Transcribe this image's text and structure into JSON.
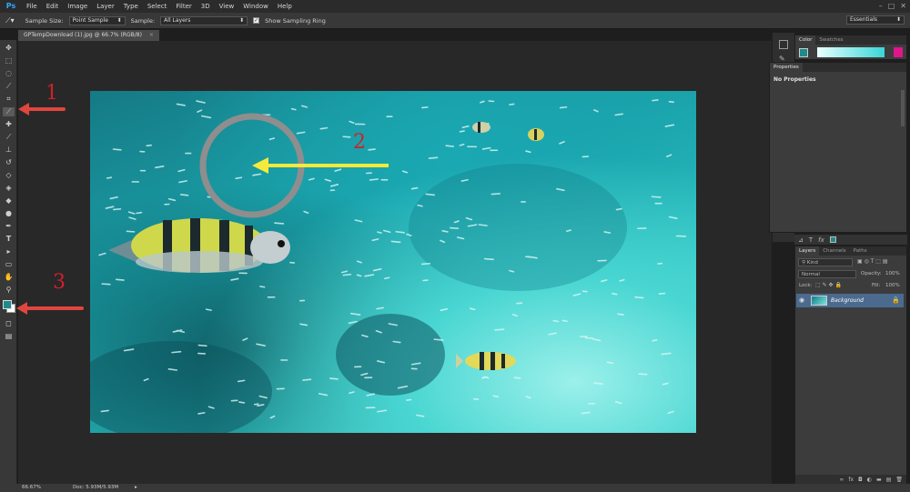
{
  "menubar": {
    "logo": "Ps",
    "items": [
      "File",
      "Edit",
      "Image",
      "Layer",
      "Type",
      "Select",
      "Filter",
      "3D",
      "View",
      "Window",
      "Help"
    ]
  },
  "options_bar": {
    "sample_size_label": "Sample Size:",
    "sample_size_value": "Point Sample",
    "sample_label": "Sample:",
    "sample_value": "All Layers",
    "show_ring_label": "Show Sampling Ring",
    "workspace_value": "Essentials"
  },
  "document": {
    "tab_title": "GPTempDownload (1).jpg @ 66.7% (RGB/8)"
  },
  "annotations": {
    "label_1": "1",
    "label_2": "2",
    "label_3": "3",
    "arrow_color": "#e0463f",
    "pointer_color": "#f5ea3b",
    "ring_color": "#8e8e8e",
    "text_color": "#d0202b"
  },
  "toolbar": {
    "foreground_color": "#1f8a8a",
    "background_color": "#ffffff"
  },
  "color_panel": {
    "tabs": [
      "Color",
      "Swatches"
    ],
    "fg_swatch": "#1f8a8a",
    "accent": "#e0158c"
  },
  "properties_panel": {
    "tab": "Properties",
    "text": "No Properties"
  },
  "layers_panel": {
    "tabs": [
      "Layers",
      "Channels",
      "Paths"
    ],
    "filter_label": "Kind",
    "blend_mode": "Normal",
    "opacity_label": "Opacity:",
    "opacity_value": "100%",
    "lock_label": "Lock:",
    "fill_label": "Fill:",
    "fill_value": "100%",
    "layer_name": "Background"
  },
  "status_bar": {
    "zoom": "66.67%",
    "doc_info": "Doc: 5.93M/5.93M"
  }
}
